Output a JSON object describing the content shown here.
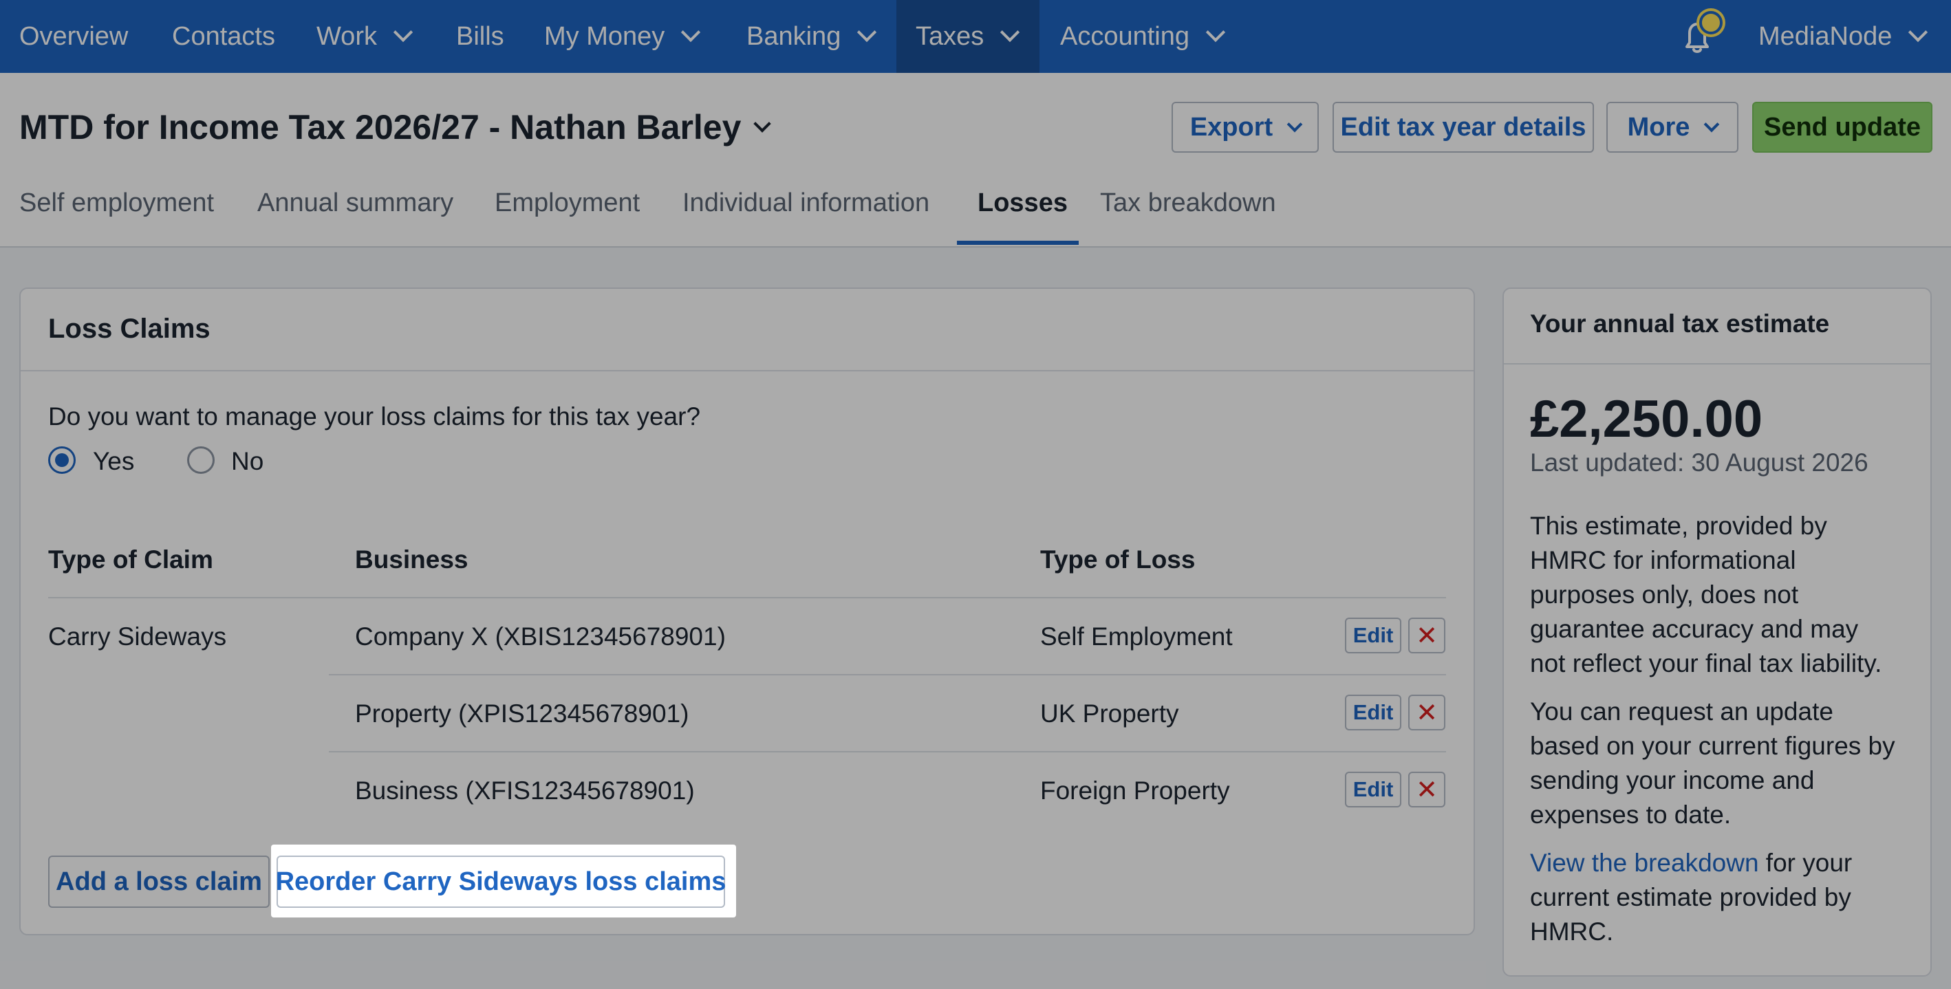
{
  "topnav": {
    "items": [
      "Overview",
      "Contacts",
      "Work",
      "Bills",
      "My Money",
      "Banking",
      "Taxes",
      "Accounting"
    ],
    "active": "Taxes",
    "account_name": "MediaNode",
    "icons": {
      "notifications": "bell-icon",
      "dropdown": "chevron-down-icon"
    }
  },
  "header": {
    "title": "MTD for Income Tax 2026/27 - Nathan Barley",
    "buttons": {
      "export": "Export",
      "edit_year": "Edit tax year details",
      "more": "More",
      "send_update": "Send update"
    }
  },
  "tabs": {
    "items": [
      "Self employment",
      "Annual summary",
      "Employment",
      "Individual information",
      "Losses",
      "Tax breakdown"
    ],
    "active": "Losses"
  },
  "loss_claims": {
    "title": "Loss Claims",
    "question": "Do you want to manage your loss claims for this tax year?",
    "options": {
      "yes": "Yes",
      "no": "No"
    },
    "selected": "Yes",
    "columns": {
      "type_of_claim": "Type of Claim",
      "business": "Business",
      "type_of_loss": "Type of Loss"
    },
    "claim_type": "Carry Sideways",
    "rows": [
      {
        "business": "Company X (XBIS12345678901)",
        "loss": "Self Employment",
        "edit": "Edit"
      },
      {
        "business": "Property (XPIS12345678901)",
        "loss": "UK Property",
        "edit": "Edit"
      },
      {
        "business": "Business (XFIS12345678901)",
        "loss": "Foreign Property",
        "edit": "Edit"
      }
    ],
    "delete_icon": "close-icon",
    "buttons": {
      "add": "Add a loss claim",
      "reorder": "Reorder Carry Sideways loss claims"
    }
  },
  "estimate": {
    "title": "Your annual tax estimate",
    "amount": "£2,250.00",
    "updated": "Last updated: 30 August 2026",
    "disclaimer_lines": [
      "This estimate, provided by",
      "HMRC for informational",
      "purposes only, does not",
      "guarantee accuracy and may",
      "not reflect your final tax liability."
    ],
    "request_lines": [
      "You can request an update",
      "based on your current figures by",
      "sending your income and",
      "expenses to date."
    ],
    "view_link": "View the breakdown",
    "view_rest_lines": [
      " for your",
      "current estimate provided by",
      "HMRC."
    ]
  },
  "colors": {
    "brand": "#1f65c1",
    "primary_button": "#8ed46f",
    "delete": "#d61f1f",
    "bell_badge": "#ffe35b"
  }
}
